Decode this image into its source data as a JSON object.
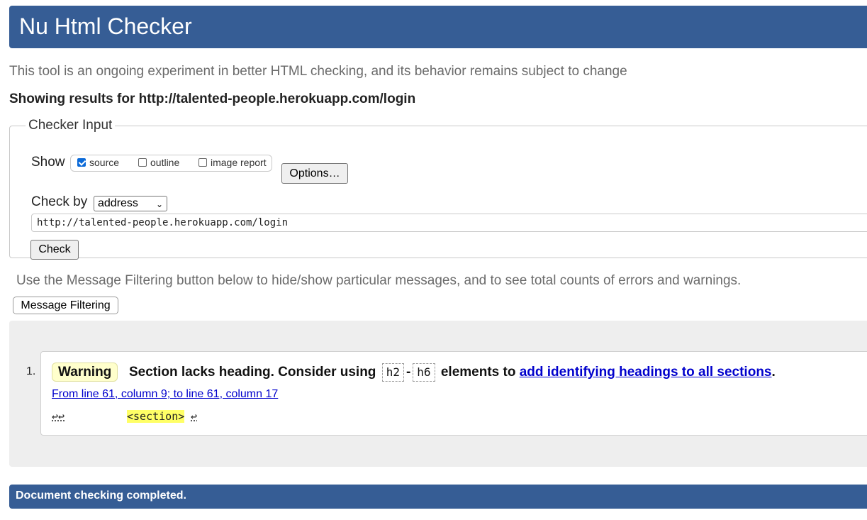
{
  "header": {
    "title": "Nu Html Checker"
  },
  "intro": "This tool is an ongoing experiment in better HTML checking, and its behavior remains subject to change",
  "showing": "Showing results for http://talented-people.herokuapp.com/login",
  "checker_input": {
    "legend": "Checker Input",
    "show_label": "Show",
    "options": [
      {
        "label": "source",
        "checked": true
      },
      {
        "label": "outline",
        "checked": false
      },
      {
        "label": "image report",
        "checked": false
      }
    ],
    "options_button": "Options…",
    "check_by_label": "Check by",
    "check_by_value": "address",
    "url_value": "http://talented-people.herokuapp.com/login",
    "check_button": "Check"
  },
  "filter_note": "Use the Message Filtering button below to hide/show particular messages, and to see total counts of errors and warnings.",
  "filter_button": "Message Filtering",
  "messages": [
    {
      "number": "1.",
      "type": "Warning",
      "text_before": "Section lacks heading. Consider using",
      "code1": "h2",
      "dash": "-",
      "code2": "h6",
      "text_middle": "elements to",
      "link_text": "add identifying headings to all sections",
      "text_end": ".",
      "location": "From line 61, column 9; to line 61, column 17",
      "extract_prefix": "↩↩",
      "extract_highlight": "<section>",
      "extract_suffix": "↩"
    }
  ],
  "footer": "Document checking completed.",
  "colors": {
    "brand": "#365d95",
    "warning_bg": "#ffffcc",
    "highlight": "#ffff66"
  }
}
